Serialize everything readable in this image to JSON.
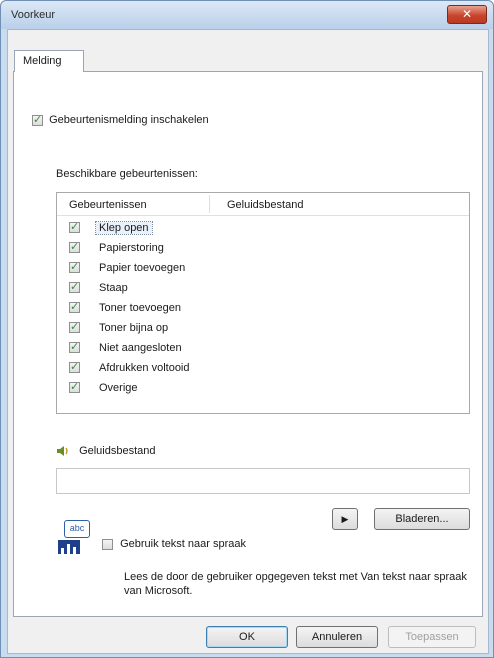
{
  "window": {
    "title": "Voorkeur",
    "close_label": "✕"
  },
  "tabs": [
    {
      "label": "Melding"
    }
  ],
  "enable_notification": {
    "label": "Gebeurtenismelding inschakelen",
    "checked": true
  },
  "available_events_label": "Beschikbare gebeurtenissen:",
  "events_list": {
    "columns": [
      "Gebeurtenissen",
      "Geluidsbestand"
    ],
    "rows": [
      {
        "label": "Klep open",
        "checked": true,
        "selected": true
      },
      {
        "label": "Papierstoring",
        "checked": true
      },
      {
        "label": "Papier toevoegen",
        "checked": true
      },
      {
        "label": "Staap",
        "checked": true
      },
      {
        "label": "Toner toevoegen",
        "checked": true
      },
      {
        "label": "Toner bijna op",
        "checked": true
      },
      {
        "label": "Niet aangesloten",
        "checked": true
      },
      {
        "label": "Afdrukken voltooid",
        "checked": true
      },
      {
        "label": "Overige",
        "checked": true
      }
    ]
  },
  "sound_file": {
    "label": "Geluidsbestand",
    "value": ""
  },
  "play_button": {
    "label": "▶"
  },
  "browse_button": {
    "label": "Bladeren..."
  },
  "tts": {
    "checkbox_label": "Gebruik tekst naar spraak",
    "checked": false,
    "icon_text": "abc"
  },
  "description": "Lees de door de gebruiker opgegeven tekst met Van tekst naar spraak van Microsoft.",
  "footer": {
    "ok": "OK",
    "cancel": "Annuleren",
    "apply": "Toepassen"
  },
  "colors": {
    "accent": "#3c7fb1",
    "title_bar": "#c9dbef",
    "close": "#c9452d"
  }
}
